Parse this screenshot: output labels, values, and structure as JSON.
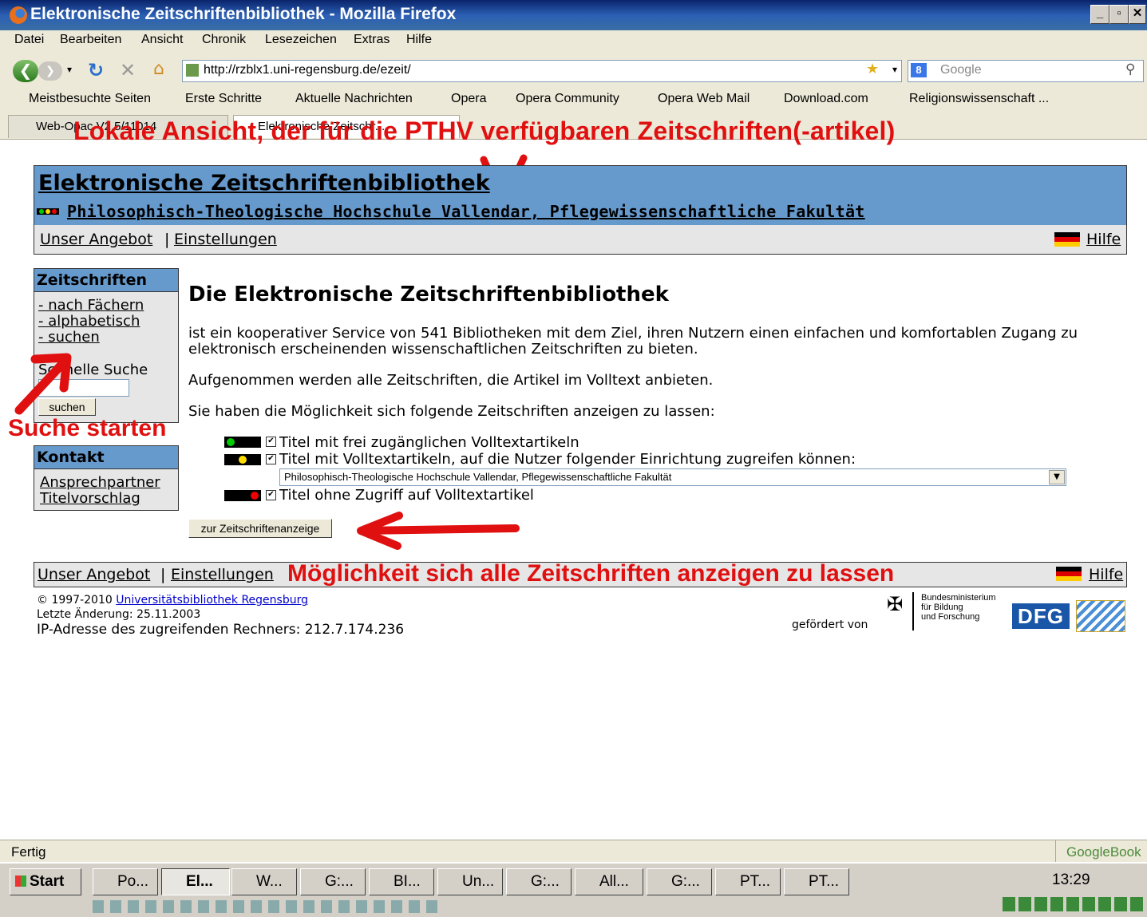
{
  "window": {
    "title": "Elektronische Zeitschriftenbibliothek - Mozilla Firefox"
  },
  "menu": [
    "Datei",
    "Bearbeiten",
    "Ansicht",
    "Chronik",
    "Lesezeichen",
    "Extras",
    "Hilfe"
  ],
  "url": "http://rzblx1.uni-regensburg.de/ezeit/",
  "search_placeholder": "Google",
  "bookmarks": [
    "Meistbesuchte Seiten",
    "Erste Schritte",
    "Aktuelle Nachrichten",
    "Opera",
    "Opera Community",
    "Opera Web Mail",
    "Download.com",
    "Religionswissenschaft ..."
  ],
  "tabs": [
    "Web-Opac V2.5/11014",
    "Elektronische Zeitschr..."
  ],
  "annotations": {
    "top": "Lokale Ansicht, der für die PTHV verfügbaren Zeitschriften(-artikel)",
    "search": "Suche starten",
    "bottom": "Möglichkeit sich alle Zeitschriften anzeigen zu lassen"
  },
  "ezb": {
    "title": "Elektronische Zeitschriftenbibliothek",
    "institution": "Philosophisch-Theologische Hochschule Vallendar, Pflegewissenschaftliche Fakultät",
    "nav_offer": "Unser Angebot",
    "nav_sep": "|",
    "nav_settings": "Einstellungen",
    "nav_help": "Hilfe"
  },
  "sidebar": {
    "journals_head": "Zeitschriften",
    "links": [
      "- nach Fächern",
      "- alphabetisch",
      "- suchen"
    ],
    "quick_search_label": "Schnelle Suche",
    "quick_search_button": "suchen",
    "contact_head": "Kontakt",
    "contact_links": [
      "Ansprechpartner",
      "Titelvorschlag"
    ]
  },
  "main": {
    "heading": "Die Elektronische Zeitschriftenbibliothek",
    "para1": "ist ein kooperativer Service von 541 Bibliotheken mit dem Ziel, ihren Nutzern einen einfachen und komfortablen Zugang zu elektronisch erscheinenden wissenschaftlichen Zeitschriften zu bieten.",
    "para2": "Aufgenommen werden alle Zeitschriften, die Artikel im Volltext anbieten.",
    "para3": "Sie haben die Möglichkeit sich folgende Zeitschriften anzeigen zu lassen:",
    "options": [
      {
        "label": "Titel mit frei zugänglichen Volltextartikeln",
        "color": "#00cc00",
        "checked": true
      },
      {
        "label": "Titel mit Volltextartikeln, auf die Nutzer folgender Einrichtung zugreifen können:",
        "color": "#ffdd00",
        "checked": true
      },
      {
        "label": "Titel ohne Zugriff auf Volltextartikel",
        "color": "#ee0000",
        "checked": true
      }
    ],
    "select_value": "Philosophisch-Theologische Hochschule Vallendar, Pflegewissenschaftliche Fakultät",
    "submit": "zur Zeitschriftenanzeige"
  },
  "footer": {
    "copyright": "© 1997-2010",
    "copyright_link": "Universitätsbibliothek Regensburg",
    "last_change": "Letzte Änderung: 25.11.2003",
    "ip": "IP-Adresse des zugreifenden Rechners: 212.7.174.236",
    "funded_by": "gefördert von",
    "bmbf": [
      "Bundesministerium",
      "für Bildung",
      "und Forschung"
    ],
    "dfg": "DFG"
  },
  "status": {
    "left": "Fertig",
    "right": "GoogleBook"
  },
  "taskbar": {
    "start": "Start",
    "items": [
      "Po...",
      "El...",
      "W...",
      "G:...",
      "BI...",
      "Un...",
      "G:...",
      "All...",
      "G:...",
      "PT...",
      "PT..."
    ],
    "clock": "13:29"
  }
}
